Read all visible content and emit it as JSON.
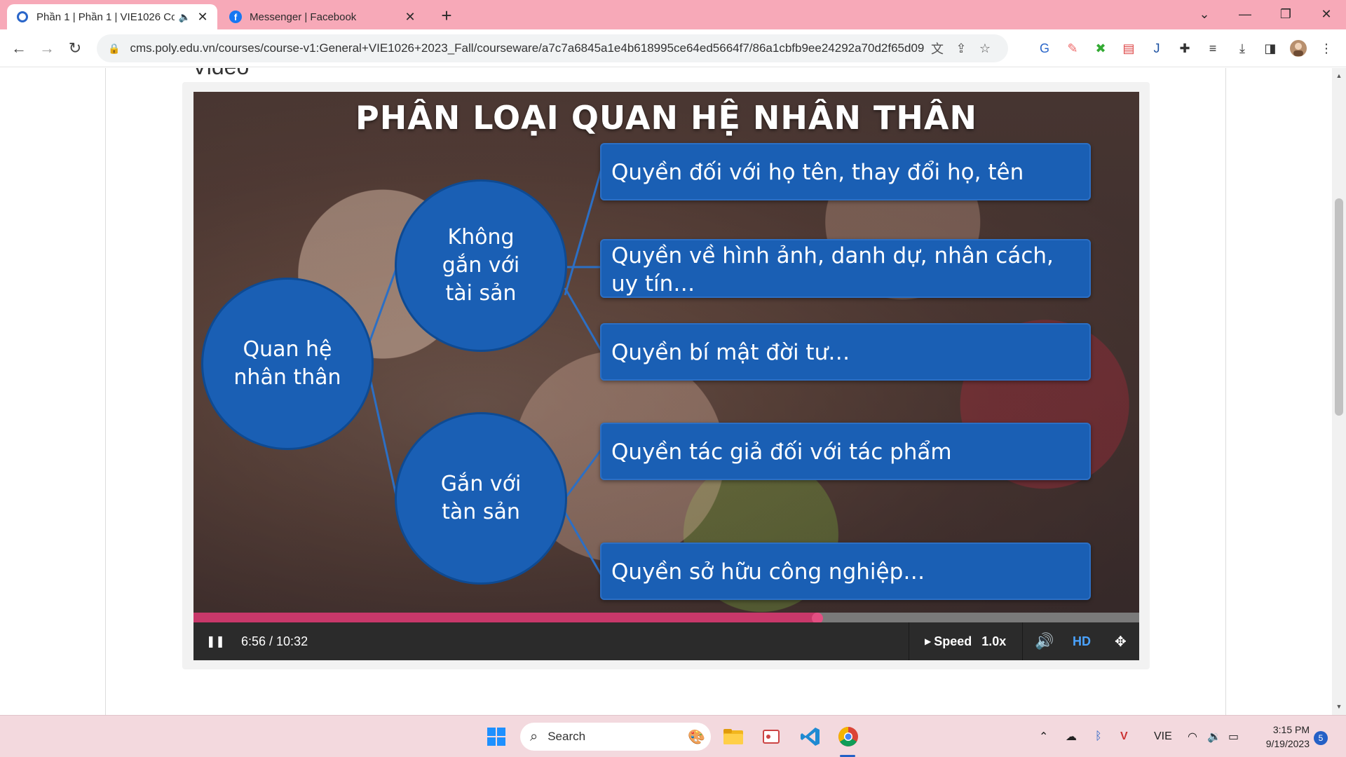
{
  "browser": {
    "tabs": [
      {
        "title": "Phần 1 | Phần 1 | VIE1026 Co",
        "favicon": "ring-icon",
        "muted_icon": "speaker-icon",
        "active": true
      },
      {
        "title": "Messenger | Facebook",
        "favicon": "facebook-icon",
        "active": false
      }
    ],
    "new_tab": "+",
    "url": "cms.poly.edu.vn/courses/course-v1:General+VIE1026+2023_Fall/courseware/a7c7a6845a1e4b618995ce64ed5664f7/86a1cbfb9ee24292a70d2f65d09...",
    "colors": {
      "tabstrip": "#f7a9b8",
      "omnibox": "#f1f3f4"
    }
  },
  "page": {
    "section_title": "Video"
  },
  "slide": {
    "title": "PHÂN LOẠI QUAN HỆ NHÂN THÂN",
    "root": "Quan hệ\nnhân thân",
    "branch_top": "Không\ngắn với\ntài sản",
    "branch_bottom": "Gắn với\ntàn sản",
    "items": [
      "Quyền đối với họ tên, thay đổi họ, tên",
      "Quyền về hình ảnh, danh dự, nhân cách, uy tín…",
      "Quyền bí mật đời tư…",
      "Quyền tác giả đối với tác phẩm",
      "Quyền sở hữu công nghiệp…"
    ],
    "colors": {
      "box": "#1a5fb4"
    }
  },
  "player": {
    "time": "6:56 / 10:32",
    "progress_fraction": 0.66,
    "speed_label": "Speed",
    "speed_value": "1.0x",
    "hd_label": "HD",
    "colors": {
      "progress": "#c8386a",
      "hd": "#4aa3ff"
    }
  },
  "taskbar": {
    "search_placeholder": "Search",
    "language": "VIE",
    "time": "3:15 PM",
    "date": "9/19/2023",
    "notifications": "5"
  }
}
